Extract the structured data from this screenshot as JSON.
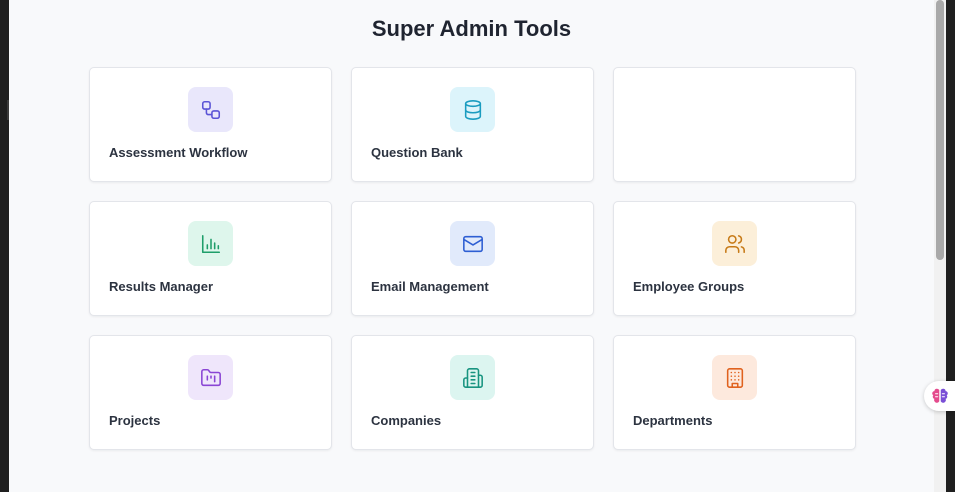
{
  "page": {
    "title": "Super Admin Tools"
  },
  "cards": [
    {
      "label": "Assessment Workflow",
      "icon": "workflow-icon",
      "icon_bg": "#e9e7fb",
      "icon_color": "#5b54d6"
    },
    {
      "label": "Question Bank",
      "icon": "database-icon",
      "icon_bg": "#dcf4fb",
      "icon_color": "#1a9cc0"
    },
    {
      "label": "",
      "icon": "",
      "icon_bg": "",
      "icon_color": ""
    },
    {
      "label": "Results Manager",
      "icon": "bar-chart-icon",
      "icon_bg": "#def6ec",
      "icon_color": "#1f9e6a"
    },
    {
      "label": "Email Management",
      "icon": "mail-icon",
      "icon_bg": "#e1eafb",
      "icon_color": "#2e5fd3"
    },
    {
      "label": "Employee Groups",
      "icon": "users-icon",
      "icon_bg": "#fcefd9",
      "icon_color": "#c77a17"
    },
    {
      "label": "Projects",
      "icon": "folder-kanban-icon",
      "icon_bg": "#efe6fb",
      "icon_color": "#8a45d4"
    },
    {
      "label": "Companies",
      "icon": "building-icon",
      "icon_bg": "#dcf5f0",
      "icon_color": "#189480"
    },
    {
      "label": "Departments",
      "icon": "office-building-icon",
      "icon_bg": "#fde9dd",
      "icon_color": "#e0621e"
    }
  ],
  "colors": {
    "page_bg": "#f8f9fb",
    "card_border": "#e3e5ea",
    "title_text": "#1f2430",
    "label_text": "#2c3340"
  }
}
